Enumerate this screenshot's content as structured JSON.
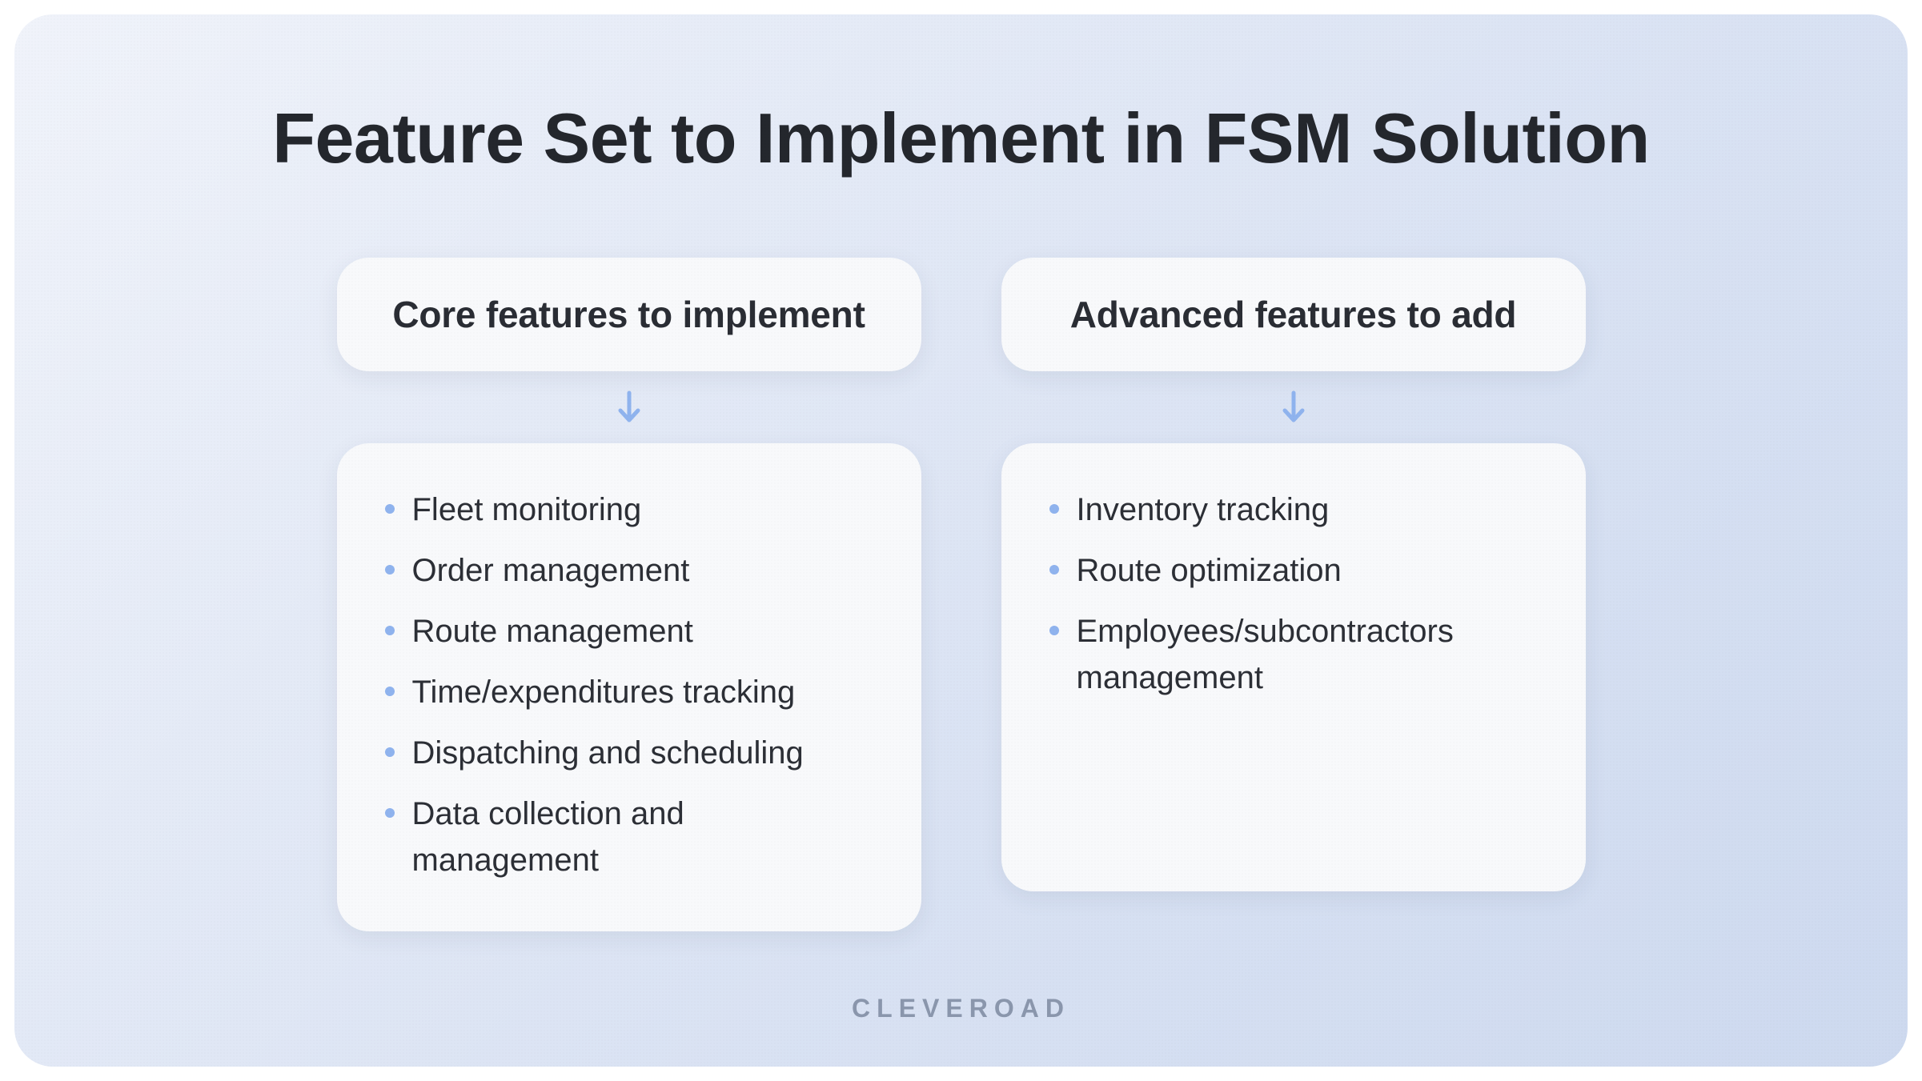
{
  "title": "Feature Set to Implement in FSM Solution",
  "columns": {
    "core": {
      "header": "Core features to implement",
      "items": [
        "Fleet monitoring",
        "Order management",
        "Route management",
        "Time/expenditures tracking",
        "Dispatching and scheduling",
        "Data collection and management"
      ]
    },
    "advanced": {
      "header": "Advanced features to add",
      "items": [
        "Inventory tracking",
        "Route optimization",
        "Employees/subcontractors management"
      ]
    }
  },
  "brand": "CLEVEROAD",
  "colors": {
    "accent": "#8fb3ee",
    "text": "#24272d",
    "card_bg": "#f8f9fb"
  }
}
